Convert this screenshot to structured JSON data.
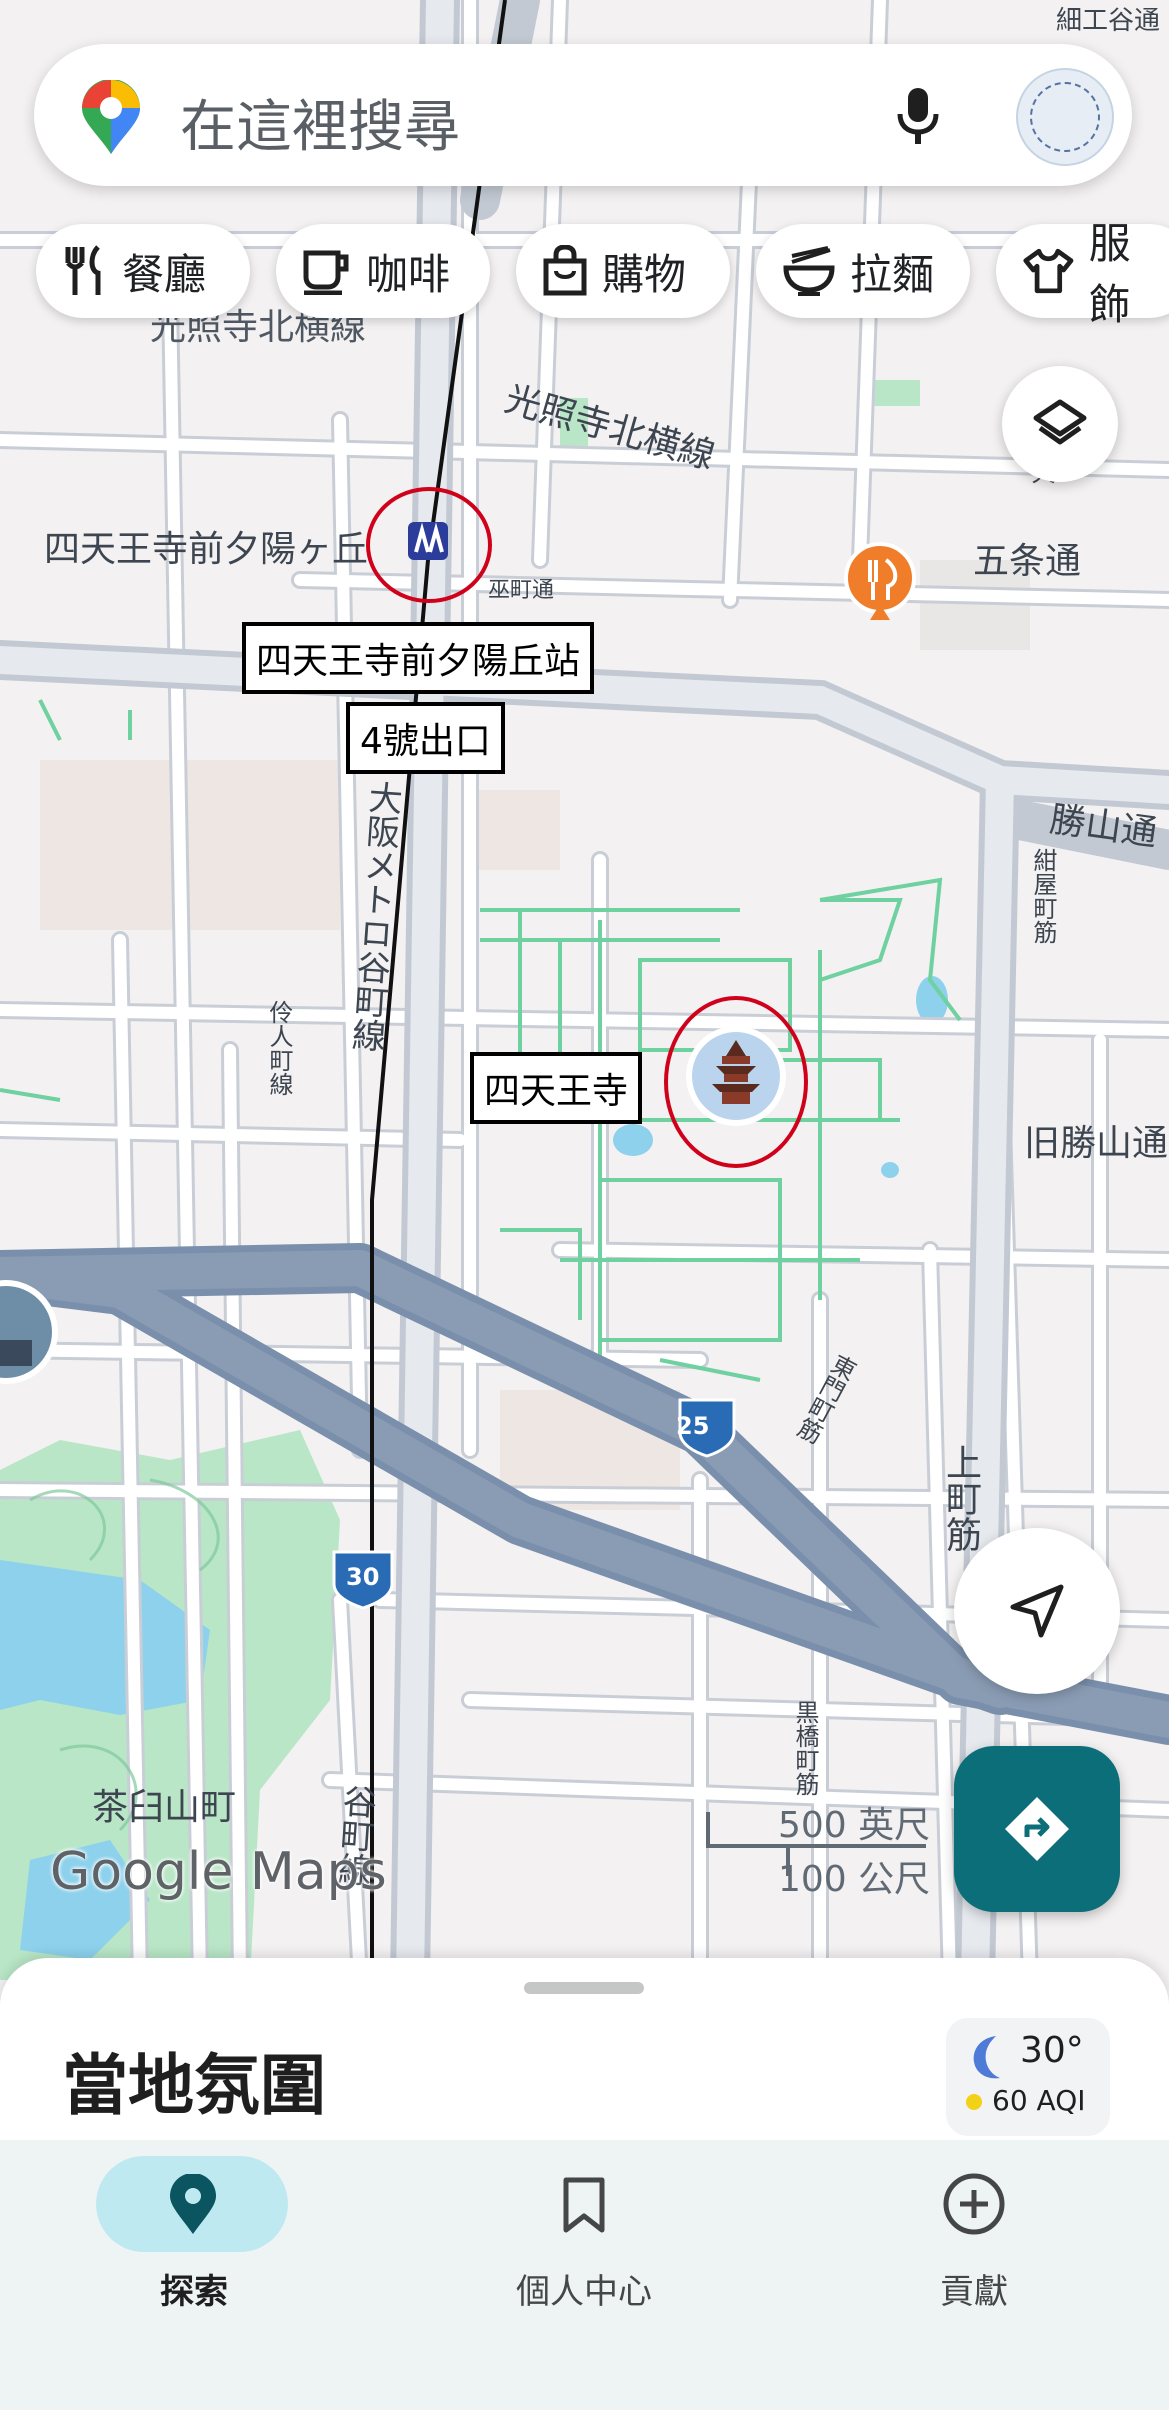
{
  "search": {
    "placeholder": "在這裡搜尋"
  },
  "chips": [
    {
      "label": "餐廳",
      "icon": "restaurant-icon"
    },
    {
      "label": "咖啡",
      "icon": "coffee-icon"
    },
    {
      "label": "購物",
      "icon": "shopping-bag-icon"
    },
    {
      "label": "拉麵",
      "icon": "ramen-icon"
    },
    {
      "label": "服飾",
      "icon": "shirt-icon"
    }
  ],
  "map": {
    "streets": {
      "top_right": "細工谷通",
      "kosho_north": "光照寺北横線",
      "kosho_north_top": "光照寺北横線",
      "gojo": "五条通",
      "katsuyama": "勝山通",
      "old_katsuyama": "旧勝山通",
      "tanimachi": "大阪メトロ谷町線",
      "tanimachi_south": "谷町線",
      "izumo": "巫町通",
      "iyohito": "伶人町線",
      "tobe": "東門町筋",
      "kuromon": "黒橋町筋",
      "uemachi": "上町筋",
      "kosho_right": "紺屋町筋",
      "chausuyama": "茶臼山町",
      "tennoji_top": "天"
    },
    "station_map_label": "四天王寺前夕陽ヶ丘",
    "station_box": "四天王寺前夕陽丘站",
    "exit_box": "4號出口",
    "temple_box": "四天王寺",
    "route_shields": [
      "25",
      "30"
    ],
    "scale": {
      "imperial": "500 英尺",
      "metric": "100 公尺"
    },
    "logo": "Google Maps",
    "colors": {
      "land": "#f3f1f1",
      "road": "#ffffff",
      "road_outline": "#c9ced6",
      "highway": "#8a9cb4",
      "park": "#b8e6c6",
      "water": "#8dd1ec",
      "path": "#6fd0a0",
      "accent": "#0b6e78",
      "annotation": "#d0021b"
    }
  },
  "sheet": {
    "title": "當地氛圍",
    "weather": {
      "temp": "30°",
      "aqi": "60 AQI"
    }
  },
  "nav": [
    {
      "label": "探索",
      "icon": "location-pin-icon",
      "active": true
    },
    {
      "label": "個人中心",
      "icon": "bookmark-icon",
      "active": false
    },
    {
      "label": "貢獻",
      "icon": "add-circle-icon",
      "active": false
    }
  ]
}
